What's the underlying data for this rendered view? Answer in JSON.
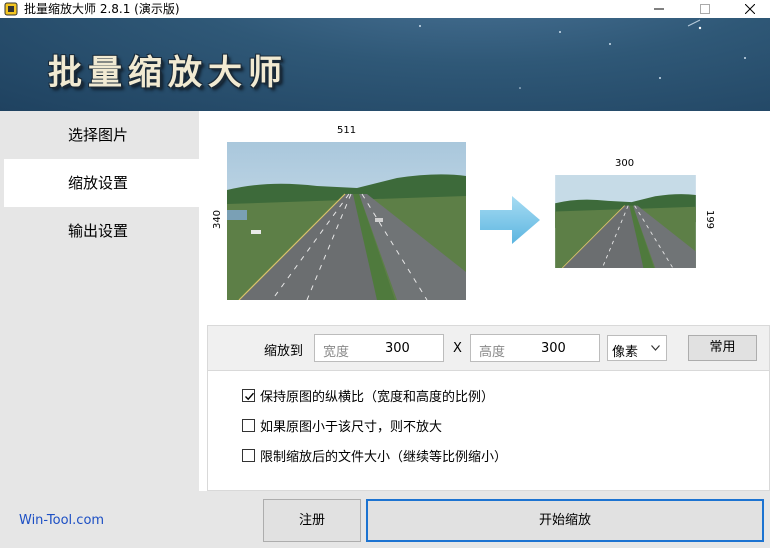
{
  "window": {
    "title": "批量缩放大师 2.8.1 (演示版)",
    "icons": [
      "app-icon",
      "minimize-icon",
      "maximize-icon",
      "close-icon"
    ]
  },
  "banner": {
    "logo_text": "批量缩放大师"
  },
  "sidebar": {
    "items": [
      {
        "label": "选择图片",
        "active": false
      },
      {
        "label": "缩放设置",
        "active": true
      },
      {
        "label": "输出设置",
        "active": false
      }
    ]
  },
  "preview": {
    "original": {
      "width_label": "511",
      "height_label": "340"
    },
    "result": {
      "width_label": "300",
      "height_label": "199"
    },
    "arrow_color": "#6fc3e8"
  },
  "resize": {
    "label": "缩放到",
    "width_placeholder": "宽度",
    "width_value": "300",
    "separator": "X",
    "height_placeholder": "高度",
    "height_value": "300",
    "unit": "像素",
    "common_button": "常用"
  },
  "options": [
    {
      "label": "保持原图的纵横比（宽度和高度的比例）",
      "checked": true
    },
    {
      "label": "如果原图小于该尺寸，则不放大",
      "checked": false
    },
    {
      "label": "限制缩放后的文件大小（继续等比例缩小）",
      "checked": false
    }
  ],
  "footer": {
    "brand": "Win-Tool.com",
    "register_button": "注册",
    "start_button": "开始缩放"
  },
  "colors": {
    "banner_bg": "#2f5877",
    "sidebar_bg": "#e6e6e6",
    "accent": "#1c73d1",
    "link": "#1c4fc4"
  }
}
